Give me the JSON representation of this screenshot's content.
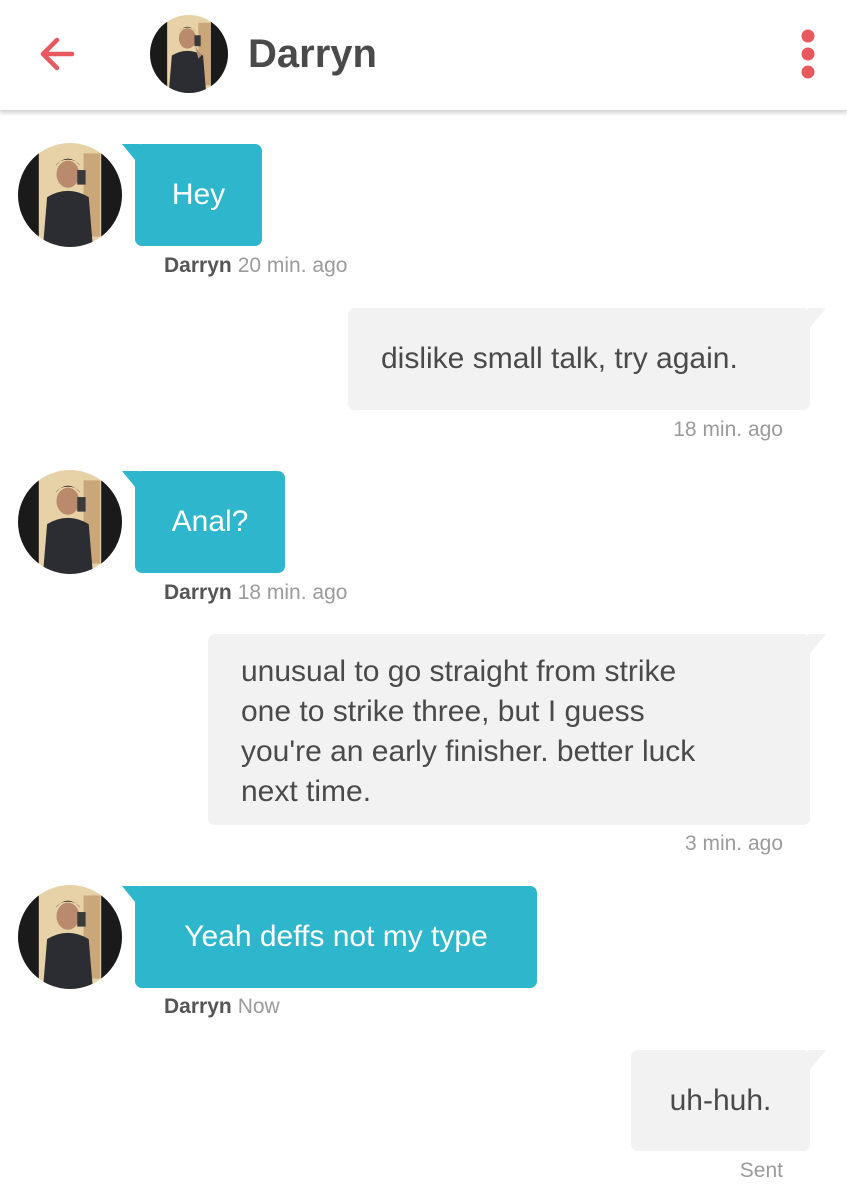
{
  "header": {
    "title": "Darryn",
    "accent_color": "#e8595f",
    "back_icon": "back-arrow-icon",
    "menu_icon": "vertical-dots-icon"
  },
  "messages": [
    {
      "direction": "incoming",
      "text": "Hey",
      "sender": "Darryn",
      "time": "20 min. ago"
    },
    {
      "direction": "outgoing",
      "text": "dislike small talk, try again.",
      "time": "18 min. ago"
    },
    {
      "direction": "incoming",
      "text": "Anal?",
      "sender": "Darryn",
      "time": "18 min. ago"
    },
    {
      "direction": "outgoing",
      "lines": [
        "unusual to go straight from strike",
        "one to strike three, but I guess",
        "you're an early finisher. better luck",
        "next time."
      ],
      "time": "3 min. ago"
    },
    {
      "direction": "incoming",
      "text": "Yeah deffs not my type",
      "sender": "Darryn",
      "time": "Now"
    },
    {
      "direction": "outgoing",
      "text": "uh-huh.",
      "time": "Sent"
    }
  ],
  "colors": {
    "incoming_bubble": "#2eb6cc",
    "outgoing_bubble": "#f2f2f2"
  }
}
